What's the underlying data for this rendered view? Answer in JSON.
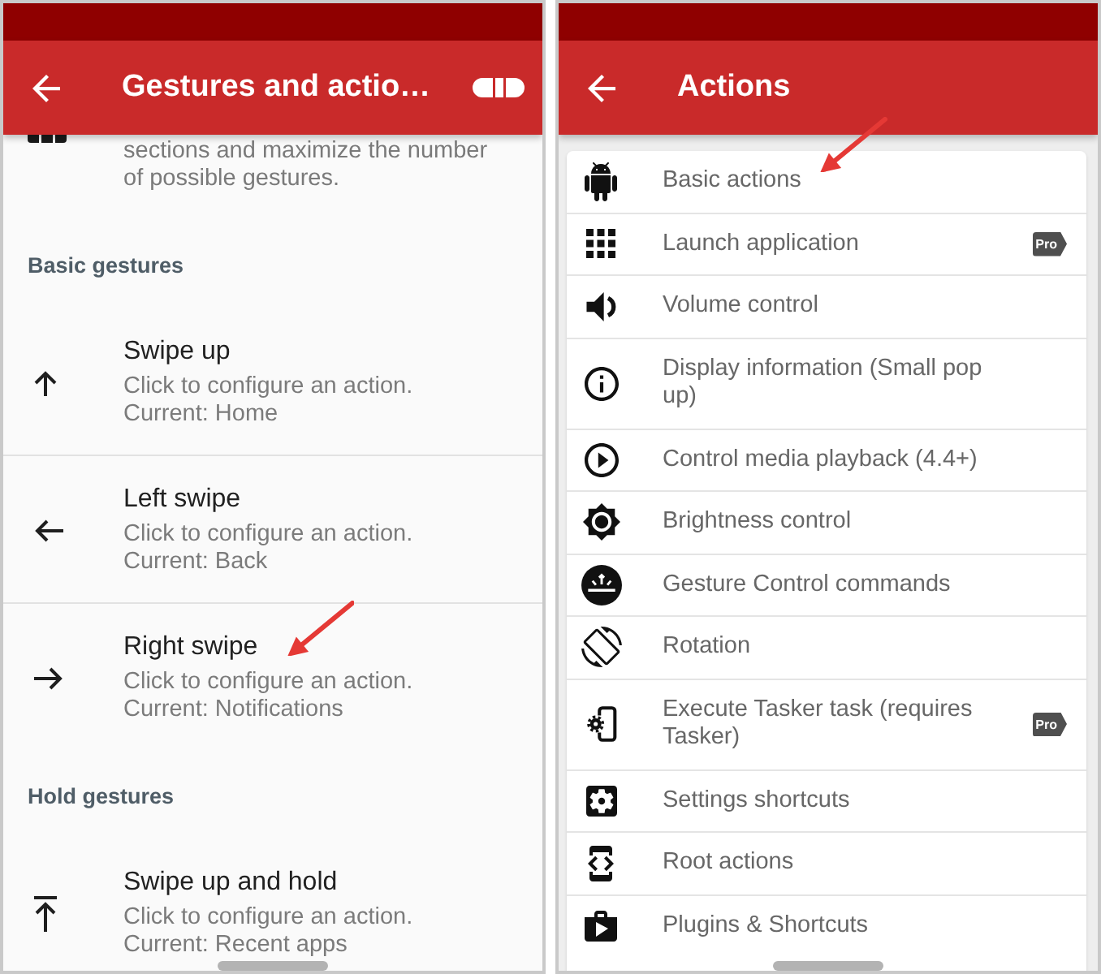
{
  "gestures_screen": {
    "title": "Gestures and actio…",
    "description": "sections and maximize the number of possible gestures.",
    "sections": [
      {
        "header": "Basic gestures",
        "items": [
          {
            "title": "Swipe up",
            "summary": "Click to configure an action.",
            "current": "Current: Home",
            "annotated": false
          },
          {
            "title": "Left swipe",
            "summary": "Click to configure an action.",
            "current": "Current: Back",
            "annotated": false
          },
          {
            "title": "Right swipe",
            "summary": "Click to configure an action.",
            "current": "Current: Notifications",
            "annotated": true
          }
        ]
      },
      {
        "header": "Hold gestures",
        "items": [
          {
            "title": "Swipe up and hold",
            "summary": "Click to configure an action.",
            "current": "Current: Recent apps",
            "annotated": false
          }
        ]
      }
    ]
  },
  "actions_screen": {
    "title": "Actions",
    "actions": [
      {
        "label": "Basic actions",
        "annotated": true
      },
      {
        "label": "Launch application",
        "badge": "Pro",
        "annotated": false
      },
      {
        "label": "Volume control",
        "annotated": false
      },
      {
        "label": "Display information (Small pop up)",
        "annotated": false
      },
      {
        "label": "Control media playback (4.4+)",
        "annotated": false
      },
      {
        "label": "Brightness control",
        "annotated": false
      },
      {
        "label": "Gesture Control commands",
        "annotated": false
      },
      {
        "label": "Rotation",
        "annotated": false
      },
      {
        "label": "Execute Tasker task (requires Tasker)",
        "badge": "Pro",
        "annotated": false
      },
      {
        "label": "Settings shortcuts",
        "annotated": false
      },
      {
        "label": "Root actions",
        "annotated": false
      },
      {
        "label": "Plugins & Shortcuts",
        "annotated": false
      }
    ]
  }
}
